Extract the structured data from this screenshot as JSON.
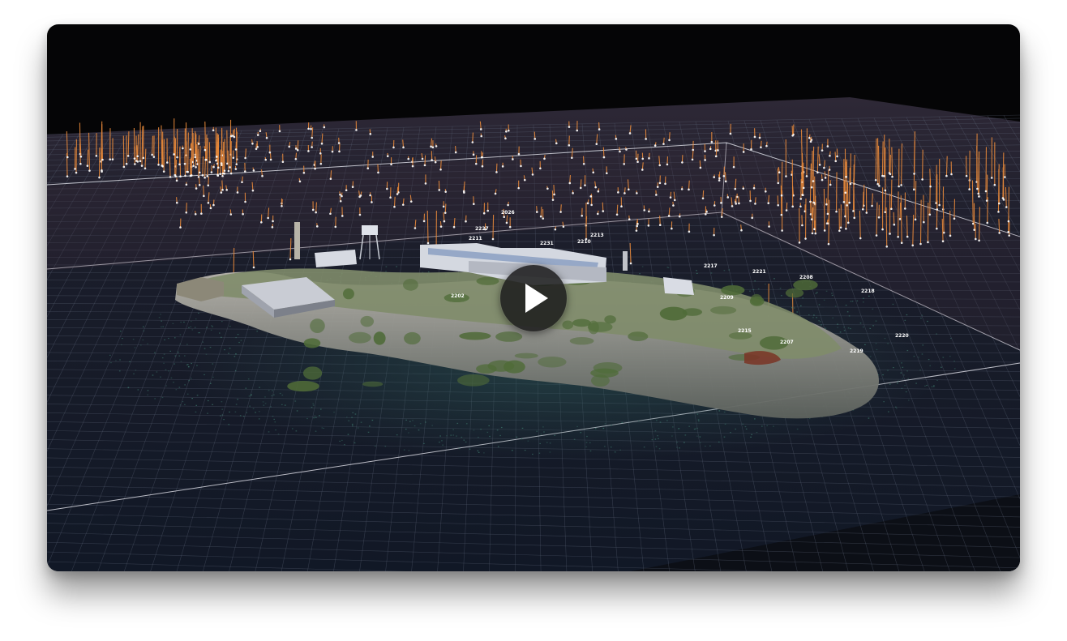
{
  "video": {
    "play_icon": "play-icon",
    "colors": {
      "background": "#050506",
      "floor": "#131a28",
      "back_plane": "#2a2432",
      "grid_line": "#5a6275",
      "boundary_line": "#e6e6ee",
      "pole": "#e8893a",
      "water_noise": "#3f7a6e",
      "cliff": "#9a9a96",
      "vegetation": "#4f6b38",
      "building": "#c8ccd6"
    }
  },
  "markers": [
    {
      "label": "2026"
    },
    {
      "label": "2227"
    },
    {
      "label": "2211"
    },
    {
      "label": "2213"
    },
    {
      "label": "2210"
    },
    {
      "label": "2231"
    },
    {
      "label": "2217"
    },
    {
      "label": "2221"
    },
    {
      "label": "2208"
    },
    {
      "label": "2218"
    },
    {
      "label": "2220"
    },
    {
      "label": "2219"
    },
    {
      "label": "2209"
    },
    {
      "label": "2202"
    },
    {
      "label": "2207"
    },
    {
      "label": "2215"
    }
  ]
}
